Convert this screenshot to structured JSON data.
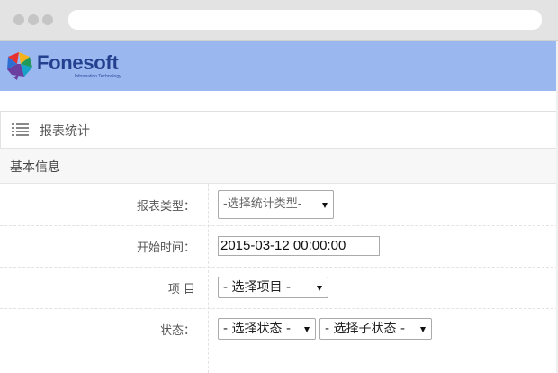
{
  "brand": {
    "name": "Fonesoft",
    "tagline": "Information Technology",
    "colors": {
      "header_bg": "#9bb7ef",
      "logo_text": "#23408f"
    }
  },
  "panel": {
    "title": "报表统计",
    "icon": "list-icon",
    "section_title": "基本信息"
  },
  "form": {
    "report_type": {
      "label": "报表类型：",
      "value": "-选择统计类型-"
    },
    "start_time": {
      "label": "开始时间：",
      "value": "2015-03-12 00:00:00"
    },
    "project": {
      "label": "项 目",
      "value": "- 选择项目 -"
    },
    "status": {
      "label": "状态：",
      "value": "- 选择状态 -",
      "sub_value": "- 选择子状态 -"
    }
  }
}
